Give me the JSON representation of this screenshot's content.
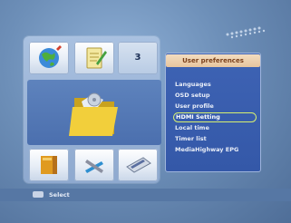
{
  "screen": {
    "menu_title": "User preferences",
    "menu_items": [
      {
        "label": "Languages",
        "selected": false
      },
      {
        "label": "OSD setup",
        "selected": false
      },
      {
        "label": "User profile",
        "selected": false
      },
      {
        "label": "HDMI Setting",
        "selected": true
      },
      {
        "label": "Local time",
        "selected": false
      },
      {
        "label": "Timer list",
        "selected": false
      },
      {
        "label": "MediaHighway EPG",
        "selected": false
      }
    ],
    "tiles": [
      {
        "icon": "globe-icon"
      },
      {
        "icon": "notepad-icon"
      },
      {
        "number": "3"
      },
      {
        "icon": "folder-icon"
      },
      {
        "icon": "book-icon"
      },
      {
        "icon": "tools-icon"
      },
      {
        "icon": "card-icon"
      }
    ]
  },
  "footer": {
    "select_label": "Select"
  },
  "colors": {
    "background": "#6d8fb8",
    "menu_bg": "#3e63b4",
    "menu_title_bg": "#f3ddc0",
    "selection_outline": "#d8f070"
  }
}
